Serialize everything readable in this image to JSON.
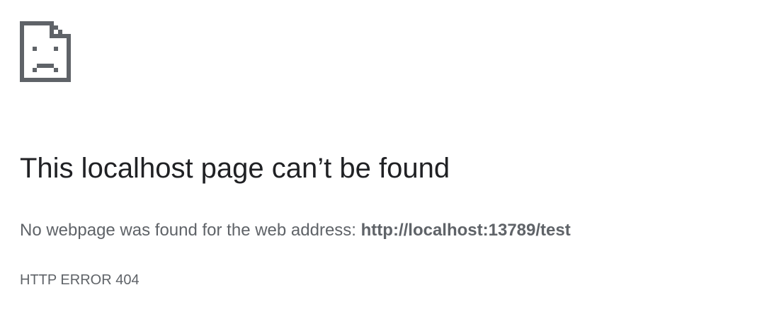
{
  "error_page": {
    "icon": "sad-page-icon",
    "title": "This localhost page can’t be found",
    "message_prefix": "No webpage was found for the web address:",
    "address": "http://localhost:13789/test",
    "error_code": "HTTP ERROR 404"
  },
  "colors": {
    "title": "#202124",
    "body_text": "#5f6368",
    "icon": "#5f6368",
    "background": "#ffffff"
  }
}
